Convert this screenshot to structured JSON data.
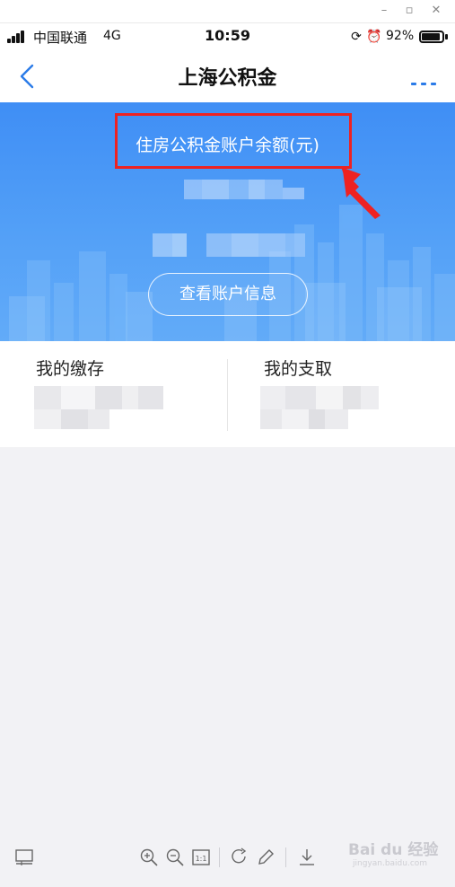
{
  "status_bar": {
    "carrier": "中国联通",
    "network": "4G",
    "time": "10:59",
    "battery": "92%",
    "battery_level": 0.92
  },
  "nav": {
    "title": "上海公积金"
  },
  "banner": {
    "balance_label": "住房公积金账户余额(元)",
    "view_button": "查看账户信息"
  },
  "summary": {
    "deposit_label": "我的缴存",
    "withdraw_label": "我的支取"
  },
  "watermark": {
    "brand": "Bai du 经验",
    "sub": "jingyan.baidu.com"
  },
  "colors": {
    "accent": "#2b7be8",
    "banner_top": "#3f8ef5",
    "banner_bottom": "#62abf8",
    "highlight": "#ee2222"
  }
}
